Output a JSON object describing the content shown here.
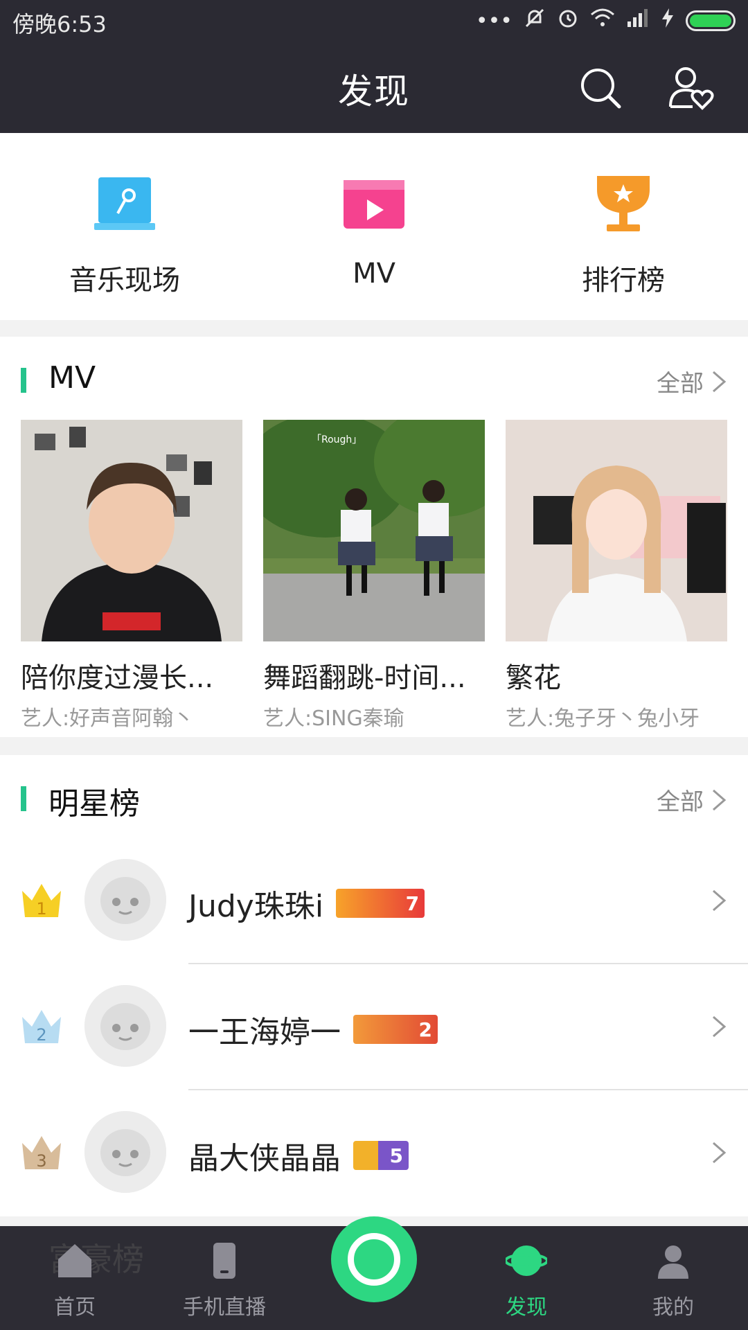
{
  "status": {
    "time": "傍晚6:53",
    "dots": "•••"
  },
  "header": {
    "title": "发现",
    "search_icon": "search-icon",
    "friends_icon": "user-heart-icon"
  },
  "categories": [
    {
      "label": "音乐现场",
      "icon": "live-stage-icon",
      "color": "#3ab7f0"
    },
    {
      "label": "MV",
      "icon": "mv-play-icon",
      "color": "#f5428f"
    },
    {
      "label": "排行榜",
      "icon": "trophy-icon",
      "color": "#f59a2a"
    }
  ],
  "mv_section": {
    "title": "MV",
    "more": "全部",
    "items": [
      {
        "title": "陪你度过漫长...",
        "artist": "艺人:好声音阿翰丶"
      },
      {
        "title": "舞蹈翻跳-时间...",
        "artist": "艺人:SING秦瑜",
        "overlay": "「Rough」"
      },
      {
        "title": "繁花",
        "artist": "艺人:兔子牙丶兔小牙"
      }
    ]
  },
  "star_section": {
    "title": "明星榜",
    "more": "全部",
    "items": [
      {
        "rank": "1",
        "name": "Judy珠珠i",
        "badge_level": "7",
        "crown_color": "#f6cf25"
      },
      {
        "rank": "2",
        "name": "一王海婷一",
        "badge_level": "2",
        "crown_color": "#b7dcf2"
      },
      {
        "rank": "3",
        "name": "晶大侠晶晶",
        "badge_level": "5",
        "crown_color": "#d8bc9a"
      }
    ]
  },
  "next_section": {
    "title": "富豪榜"
  },
  "bottom_nav": [
    {
      "label": "首页",
      "icon": "home-icon"
    },
    {
      "label": "手机直播",
      "icon": "phone-icon"
    },
    {
      "label": "",
      "icon": "record-icon"
    },
    {
      "label": "发现",
      "icon": "discover-icon"
    },
    {
      "label": "我的",
      "icon": "profile-icon"
    }
  ],
  "accent_color": "#25c38c"
}
